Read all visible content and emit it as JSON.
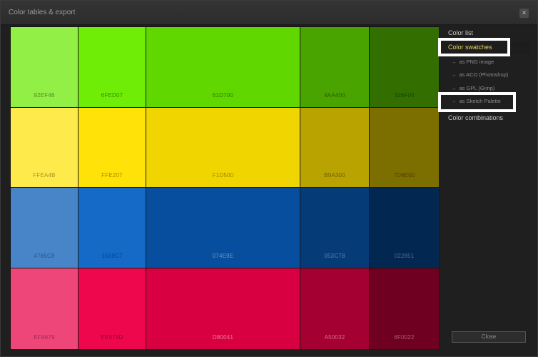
{
  "dialog": {
    "title": "Color tables & export",
    "close_icon": "×"
  },
  "swatches": [
    [
      {
        "hex": "#92EF46",
        "label": "92EF46",
        "text": "#4f8a1d"
      },
      {
        "hex": "#6FED07",
        "label": "6FED07",
        "text": "#3c8800"
      },
      {
        "hex": "#61D700",
        "label": "61D700",
        "text": "#347800"
      },
      {
        "hex": "#4AA400",
        "label": "4AA400",
        "text": "#256000"
      },
      {
        "hex": "#326F00",
        "label": "326F00",
        "text": "#1a4200"
      }
    ],
    [
      {
        "hex": "#FFEA4B",
        "label": "FFEA4B",
        "text": "#a79620"
      },
      {
        "hex": "#FFE207",
        "label": "FFE207",
        "text": "#a38f00"
      },
      {
        "hex": "#F1D500",
        "label": "F1D500",
        "text": "#9a8800"
      },
      {
        "hex": "#B9A300",
        "label": "B9A300",
        "text": "#6f6100"
      },
      {
        "hex": "#7D6E00",
        "label": "7D6E00",
        "text": "#4a4100"
      }
    ],
    [
      {
        "hex": "#4785C8",
        "label": "4785C8",
        "text": "#2a5487"
      },
      {
        "hex": "#1569C7",
        "label": "1569C7",
        "text": "#0c4488"
      },
      {
        "hex": "#074E9E",
        "label": "074E9E",
        "text": "#6e95c4"
      },
      {
        "hex": "#053C78",
        "label": "053C78",
        "text": "#5a7fa8"
      },
      {
        "hex": "#022851",
        "label": "022851",
        "text": "#4d6a8c"
      }
    ],
    [
      {
        "hex": "#EF4679",
        "label": "EF4679",
        "text": "#a12652"
      },
      {
        "hex": "#EE074D",
        "label": "EE074D",
        "text": "#a0002f"
      },
      {
        "hex": "#D80041",
        "label": "D80041",
        "text": "#f07a9c"
      },
      {
        "hex": "#A50032",
        "label": "A50032",
        "text": "#d86a8b"
      },
      {
        "hex": "#6F0022",
        "label": "6F0022",
        "text": "#b05a74"
      }
    ]
  ],
  "sidebar": {
    "items": [
      {
        "label": "Color list",
        "sub": false,
        "active": false
      },
      {
        "label": "Color swatches",
        "sub": false,
        "active": true
      },
      {
        "label": "as PNG image",
        "sub": true,
        "active": false
      },
      {
        "label": "as ACO (Photoshop)",
        "sub": true,
        "active": false
      },
      {
        "label": "as GPL (Gimp)",
        "sub": true,
        "active": false
      },
      {
        "label": "as Sketch Palette",
        "sub": true,
        "active": false
      },
      {
        "label": "Color combinations",
        "sub": false,
        "active": false
      }
    ],
    "arrow_glyph": "→",
    "close_label": "Close"
  }
}
